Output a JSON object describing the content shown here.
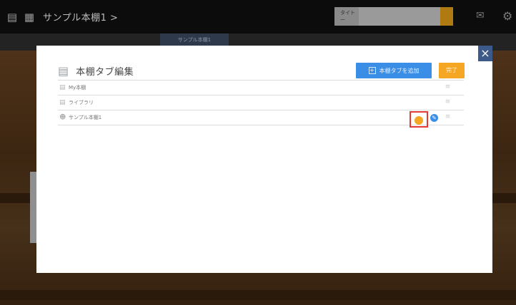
{
  "topbar": {
    "shelf_icon": "bookshelf-icon",
    "book_icon": "book-icon",
    "title": "サンプル本棚1 >",
    "search_label": "タイトー",
    "search_placeholder": "",
    "mail_icon": "mail-icon",
    "gear_icon": "gear-icon"
  },
  "background": {
    "active_tab_label": "サンプル本棚1"
  },
  "modal": {
    "title": "本棚タブ編集",
    "title_icon": "bookshelf-icon",
    "add_button_label": "本棚タブを追加",
    "add_button_icon": "plus-icon",
    "done_button_label": "完了",
    "close_glyph": "×",
    "rows": [
      {
        "label": "My本棚",
        "icon": "shelf-icon",
        "drag_glyph": "≡"
      },
      {
        "label": "ライブラリ",
        "icon": "shelf-icon",
        "drag_glyph": "≡"
      },
      {
        "label": "サンプル本棚1",
        "icon": "user-shelf-icon",
        "drag_glyph": "≡",
        "edit_glyph": "✎"
      }
    ]
  },
  "colors": {
    "accent_blue": "#3a8ee6",
    "accent_orange": "#f5a623",
    "highlight_red": "#e53935",
    "close_blue": "#3b5a8a"
  }
}
